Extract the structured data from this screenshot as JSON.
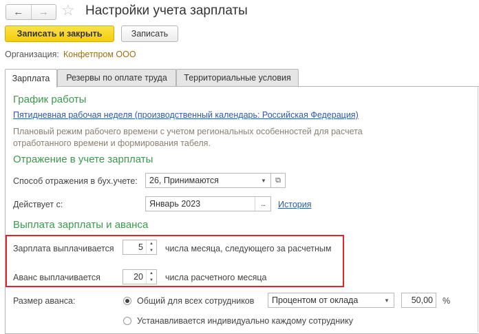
{
  "window": {
    "title": "Настройки учета зарплаты",
    "back_glyph": "←",
    "forward_glyph": "→",
    "favorite_glyph": "☆"
  },
  "toolbar": {
    "save_close_label": "Записать и закрыть",
    "save_label": "Записать"
  },
  "organization": {
    "label": "Организация:",
    "value": "Конфетпром ООО"
  },
  "tabs": [
    {
      "label": "Зарплата",
      "active": true
    },
    {
      "label": "Резервы по оплате труда",
      "active": false
    },
    {
      "label": "Территориальные условия",
      "active": false
    }
  ],
  "schedule": {
    "heading": "График работы",
    "link": "Пятидневная рабочая неделя (производственный календарь: Российская Федерация)",
    "hint_line1": "Плановый режим рабочего времени с учетом региональных особенностей для расчета",
    "hint_line2": "отработанного времени и формирования табеля."
  },
  "accounting": {
    "heading": "Отражение в учете зарплаты",
    "method_label": "Способ отражения в бух.учете:",
    "method_value": "26, Принимаются",
    "effective_label": "Действует с:",
    "effective_value": "Январь 2023",
    "history_link": "История"
  },
  "payment": {
    "heading": "Выплата зарплаты и аванса",
    "salary_label": "Зарплата выплачивается",
    "salary_day": "5",
    "salary_suffix": "числа месяца, следующего за расчетным",
    "advance_label": "Аванс выплачивается",
    "advance_day": "20",
    "advance_suffix": "числа расчетного месяца",
    "advance_size_label": "Размер аванса:",
    "option_common": "Общий для всех сотрудников",
    "option_common_selected": true,
    "method_value": "Процентом от оклада",
    "percent_value": "50,00",
    "percent_sign": "%",
    "option_individual": "Устанавливается индивидуально каждому сотруднику"
  },
  "icons": {
    "dropdown": "▼",
    "spin_up": "▲",
    "spin_down": "▼",
    "open": "⧉",
    "select": "..."
  },
  "colors": {
    "primary_button": "#f3cd0c",
    "section_heading": "#3a9a4c",
    "link": "#2c5aa8",
    "highlight_box": "#e0242b"
  }
}
